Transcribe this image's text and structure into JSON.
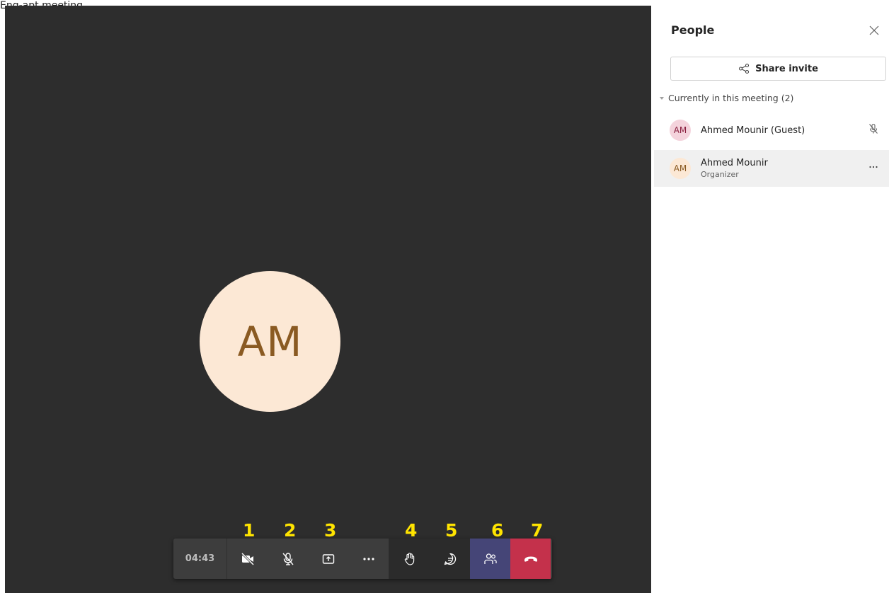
{
  "caption": "Eng-apt meeting",
  "stage": {
    "avatar_initials": "AM"
  },
  "markers": [
    "1",
    "2",
    "3",
    "4",
    "5",
    "6",
    "7"
  ],
  "toolbar": {
    "timer": "04:43"
  },
  "panel": {
    "title": "People",
    "share_label": "Share invite",
    "section_label": "Currently in this meeting (2)",
    "participants": [
      {
        "initials": "AM",
        "name": "Ahmed Mounir (Guest)"
      },
      {
        "initials": "AM",
        "name": "Ahmed Mounir",
        "role": "Organizer"
      }
    ]
  },
  "colors": {
    "hangup": "#c4314b",
    "people_active": "#454577",
    "marker": "#ffe400"
  }
}
